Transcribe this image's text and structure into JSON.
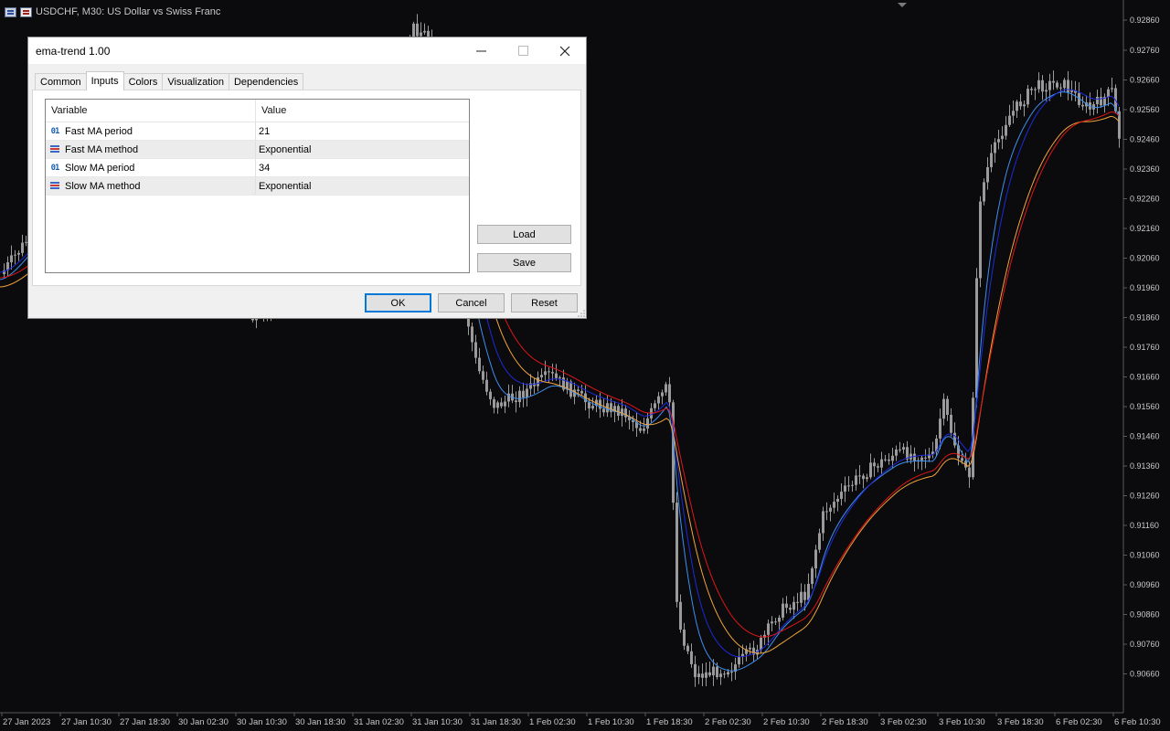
{
  "chart": {
    "symbol_label": "USDCHF, M30:  US Dollar vs Swiss Franc",
    "price_labels": [
      "0.92760",
      "0.92660",
      "0.92560",
      "0.92460",
      "0.92360",
      "0.92260",
      "0.92160",
      "0.92060",
      "0.91960",
      "0.91860",
      "0.91760",
      "0.91660",
      "0.91560",
      "0.91460",
      "0.91360",
      "0.91260",
      "0.91160",
      "0.91060",
      "0.90960",
      "0.90860",
      "0.90760",
      "0.90660"
    ],
    "top_price_label": "0.92860",
    "time_labels": [
      "27 Jan 2023",
      "27 Jan 10:30",
      "27 Jan 18:30",
      "30 Jan 02:30",
      "30 Jan 10:30",
      "30 Jan 18:30",
      "31 Jan 02:30",
      "31 Jan 10:30",
      "31 Jan 18:30",
      "1 Feb 02:30",
      "1 Feb 10:30",
      "1 Feb 18:30",
      "2 Feb 02:30",
      "2 Feb 10:30",
      "2 Feb 18:30",
      "3 Feb 02:30",
      "3 Feb 10:30",
      "3 Feb 18:30",
      "6 Feb 02:30",
      "6 Feb 10:30"
    ],
    "colors": {
      "background": "#0b0b0e",
      "candle": "#9a9a9a",
      "ema_fast_high": "#1e2ad8",
      "ema_fast_low": "#3d8ff0",
      "ema_slow_high": "#e01616",
      "ema_slow_low": "#f2a43a",
      "axis_text": "#c8c8c8"
    }
  },
  "dialog": {
    "title": "ema-trend 1.00",
    "tabs": [
      {
        "label": "Common"
      },
      {
        "label": "Inputs"
      },
      {
        "label": "Colors"
      },
      {
        "label": "Visualization"
      },
      {
        "label": "Dependencies"
      }
    ],
    "grid": {
      "col_variable": "Variable",
      "col_value": "Value",
      "rows": [
        {
          "type": "01",
          "name": "Fast MA period",
          "value": "21"
        },
        {
          "type": "enum",
          "name": "Fast MA method",
          "value": "Exponential"
        },
        {
          "type": "01",
          "name": "Slow MA period",
          "value": "34"
        },
        {
          "type": "enum",
          "name": "Slow MA method",
          "value": "Exponential"
        }
      ]
    },
    "load_label": "Load",
    "save_label": "Save",
    "ok_label": "OK",
    "cancel_label": "Cancel",
    "reset_label": "Reset"
  }
}
